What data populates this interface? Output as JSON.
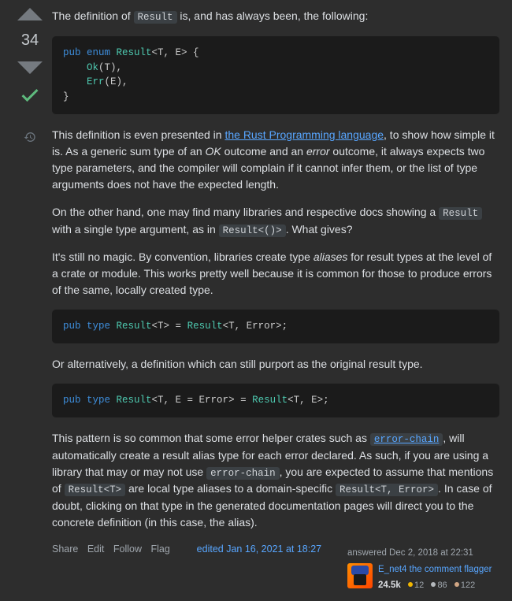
{
  "vote": {
    "score": "34"
  },
  "p1_a": "The definition of ",
  "p1_code": "Result",
  "p1_b": " is, and has always been, the following:",
  "code1": {
    "l1a": "pub",
    "l1b": " enum",
    "l1c": " Result",
    "l1d": "<T, E> {",
    "l2a": "    Ok",
    "l2b": "(T),",
    "l3a": "    Err",
    "l3b": "(E),",
    "l4": "}"
  },
  "p2_a": "This definition is even presented in ",
  "p2_link": "the Rust Programming language",
  "p2_b": ", to show how simple it is. As a generic sum type of an ",
  "p2_ok": "OK",
  "p2_c": " outcome and an ",
  "p2_err": "error",
  "p2_d": " outcome, it always expects two type parameters, and the compiler will complain if it cannot infer them, or the list of type arguments does not have the expected length.",
  "p3_a": "On the other hand, one may find many libraries and respective docs showing a ",
  "p3_code1": "Result",
  "p3_b": " with a single type argument, as in ",
  "p3_code2": "Result<()>",
  "p3_c": ". What gives?",
  "p4_a": "It's still no magic. By convention, libraries create type ",
  "p4_i": "aliases",
  "p4_b": " for result types at the level of a crate or module. This works pretty well because it is common for those to produce errors of the same, locally created type.",
  "code2": {
    "a": "pub",
    "b": " type",
    "c": " Result",
    "d": "<T> = ",
    "e": "Result",
    "f": "<T, Error>;"
  },
  "p5": "Or alternatively, a definition which can still purport as the original result type.",
  "code3": {
    "a": "pub",
    "b": " type",
    "c": " Result",
    "d": "<T, E = Error> = ",
    "e": "Result",
    "f": "<T, E>;"
  },
  "p6_a": "This pattern is so common that some error helper crates such as ",
  "p6_link": "error-chain",
  "p6_b": ", will automatically create a result alias type for each error declared. As such, if you are using a library that may or may not use ",
  "p6_code1": "error-chain",
  "p6_c": ", you are expected to assume that mentions of ",
  "p6_code2": "Result<T>",
  "p6_d": " are local type aliases to a domain-specific ",
  "p6_code3": "Result<T, Error>",
  "p6_e": ". In case of doubt, clicking on that type in the generated documentation pages will direct you to the concrete definition (in this case, the alias).",
  "actions": {
    "share": "Share",
    "edit": "Edit",
    "follow": "Follow",
    "flag": "Flag"
  },
  "edited": "edited Jan 16, 2021 at 18:27",
  "answered": "answered Dec 2, 2018 at 22:31",
  "user": {
    "name": "E_net4 the comment flagger",
    "rep": "24.5k",
    "gold": "12",
    "silver": "86",
    "bronze": "122"
  }
}
